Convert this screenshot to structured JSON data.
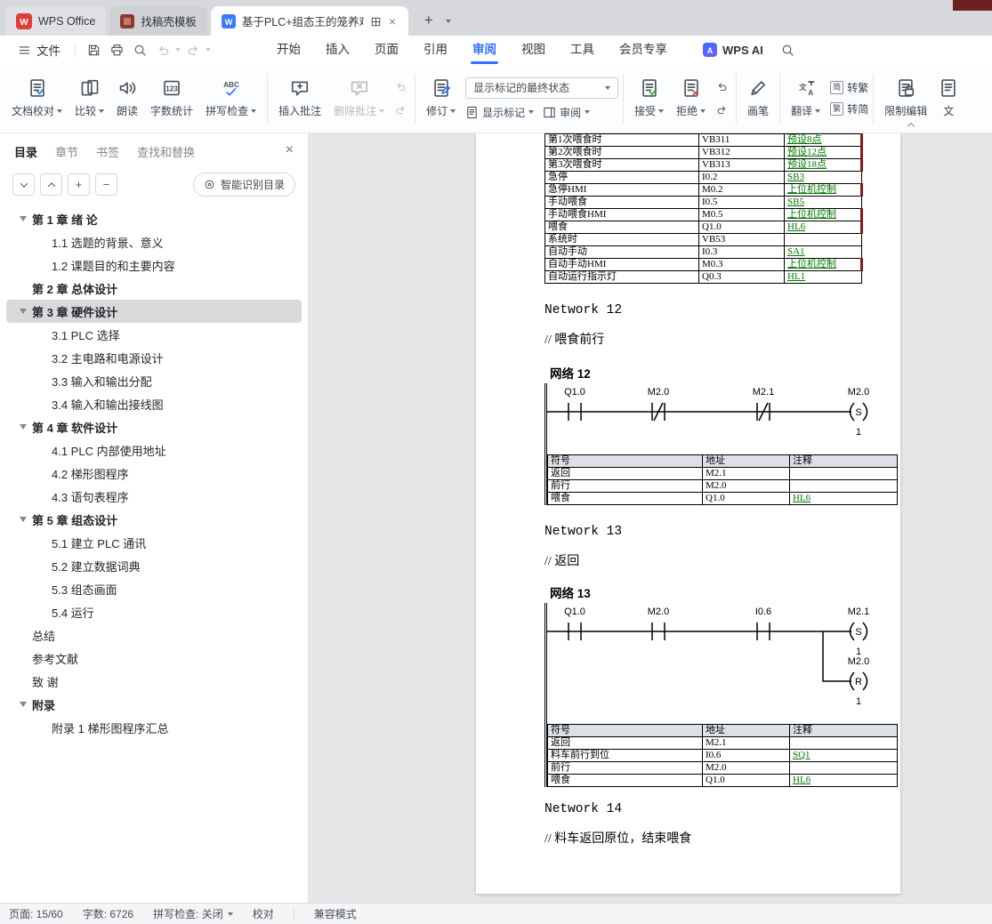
{
  "colors": {
    "accent": "#3370ff",
    "symbol_green": "#007a00",
    "revision_red": "#8b1a1a"
  },
  "titlebar": {
    "wps_tab": "WPS Office",
    "template_tab": "找稿壳模板",
    "doc_tab": "基于PLC+组态王的笼养鸡养殖",
    "new_tab_plus": "+"
  },
  "menubar": {
    "file": "文件",
    "tabs": [
      {
        "label": "开始"
      },
      {
        "label": "插入"
      },
      {
        "label": "页面"
      },
      {
        "label": "引用"
      },
      {
        "label": "审阅",
        "active": true
      },
      {
        "label": "视图"
      },
      {
        "label": "工具"
      },
      {
        "label": "会员专享"
      }
    ],
    "ai": "WPS AI"
  },
  "ribbon": {
    "proof": "文档校对",
    "compare": "比较",
    "read": "朗读",
    "word_count": "字数统计",
    "spell_check": "拼写检查",
    "insert_comment": "插入批注",
    "delete_comment": "删除批注",
    "track_changes": "修订",
    "display_state": "显示标记的最终状态",
    "show_marks": "显示标记",
    "review_pane": "审阅",
    "accept": "接受",
    "reject": "拒绝",
    "brush": "画笔",
    "translate": "翻译",
    "s2t_tag": "简",
    "s2t": "转繁",
    "t2s_tag": "繁",
    "t2s": "转简",
    "restrict_edit": "限制编辑",
    "clipped": "文"
  },
  "sidebar": {
    "tabs": [
      {
        "label": "目录",
        "active": true
      },
      {
        "label": "章节"
      },
      {
        "label": "书签"
      },
      {
        "label": "查找和替换"
      }
    ],
    "smart_toc": "智能识别目录",
    "toc": [
      {
        "label": "第 1 章 绪 论",
        "bold": true,
        "arrow": true
      },
      {
        "label": "1.1 选题的背景、意义",
        "sub": true
      },
      {
        "label": "1.2 课题目的和主要内容",
        "sub": true
      },
      {
        "label": "第 2 章 总体设计",
        "bold": true
      },
      {
        "label": "第 3 章 硬件设计",
        "bold": true,
        "arrow": true,
        "selected": true
      },
      {
        "label": "3.1 PLC 选择",
        "sub": true
      },
      {
        "label": "3.2 主电路和电源设计",
        "sub": true
      },
      {
        "label": "3.3 输入和输出分配",
        "sub": true
      },
      {
        "label": "3.4 输入和输出接线图",
        "sub": true
      },
      {
        "label": "第 4 章 软件设计",
        "bold": true,
        "arrow": true
      },
      {
        "label": "4.1 PLC 内部使用地址",
        "sub": true
      },
      {
        "label": "4.2 梯形图程序",
        "sub": true
      },
      {
        "label": "4.3 语句表程序",
        "sub": true
      },
      {
        "label": "第 5 章 组态设计",
        "bold": true,
        "arrow": true
      },
      {
        "label": "5.1 建立 PLC 通讯",
        "sub": true
      },
      {
        "label": "5.2 建立数据词典",
        "sub": true
      },
      {
        "label": "5.3 组态画面",
        "sub": true
      },
      {
        "label": "5.4 运行",
        "sub": true
      },
      {
        "label": "总结"
      },
      {
        "label": "参考文献"
      },
      {
        "label": "致 谢"
      },
      {
        "label": "附录",
        "bold": true,
        "arrow": true
      },
      {
        "label": "附录 1 梯形图程序汇总",
        "sub": true
      }
    ]
  },
  "doc": {
    "io_table_rows": [
      {
        "c": [
          "第1次喂食时",
          "VB311",
          "预设8点"
        ],
        "marked": true
      },
      {
        "c": [
          "第2次喂食时",
          "VB312",
          "预设12点"
        ],
        "marked": true
      },
      {
        "c": [
          "第3次喂食时",
          "VB313",
          "预设18点"
        ],
        "marked": true
      },
      {
        "c": [
          "急停",
          "I0.2",
          "SB3"
        ]
      },
      {
        "c": [
          "急停HMI",
          "M0.2",
          "上位机控制"
        ],
        "marked": true
      },
      {
        "c": [
          "手动喂食",
          "I0.5",
          "SB5"
        ]
      },
      {
        "c": [
          "手动喂食HMI",
          "M0.5",
          "上位机控制"
        ],
        "marked": true
      },
      {
        "c": [
          "喂食",
          "Q1.0",
          "HL6"
        ],
        "marked": true
      },
      {
        "c": [
          "系统时",
          "VB53",
          ""
        ]
      },
      {
        "c": [
          "自动手动",
          "I0.3",
          "SA1"
        ]
      },
      {
        "c": [
          "自动手动HMI",
          "M0.3",
          "上位机控制"
        ],
        "marked": true
      },
      {
        "c": [
          "自动运行指示灯",
          "Q0.3",
          "HL1"
        ]
      }
    ],
    "networks": [
      {
        "title": "Network 12",
        "comment": "// 喂食前行",
        "label": "网络 12",
        "ladder": {
          "contacts": [
            {
              "name": "Q1.0"
            },
            {
              "name": "M2.0",
              "nc": true
            },
            {
              "name": "M2.1",
              "nc": true
            }
          ],
          "coils": [
            {
              "name": "M2.0",
              "op": "S",
              "count": "1"
            }
          ]
        },
        "symbols": {
          "headers": [
            "符号",
            "地址",
            "注释"
          ],
          "rows": [
            {
              "c": [
                "返回",
                "M2.1",
                ""
              ]
            },
            {
              "c": [
                "前行",
                "M2.0",
                ""
              ]
            },
            {
              "c": [
                "喂食",
                "Q1.0",
                "HL6"
              ]
            }
          ]
        }
      },
      {
        "title": "Network 13",
        "comment": "// 返回",
        "label": "网络 13",
        "ladder": {
          "contacts": [
            {
              "name": "Q1.0"
            },
            {
              "name": "M2.0"
            },
            {
              "name": "I0.6"
            }
          ],
          "coils": [
            {
              "name": "M2.1",
              "op": "S",
              "count": "1"
            },
            {
              "name": "M2.0",
              "op": "R",
              "count": "1"
            }
          ]
        },
        "symbols": {
          "headers": [
            "符号",
            "地址",
            "注释"
          ],
          "rows": [
            {
              "c": [
                "返回",
                "M2.1",
                ""
              ]
            },
            {
              "c": [
                "料车前行到位",
                "I0.6",
                "SQ1"
              ]
            },
            {
              "c": [
                "前行",
                "M2.0",
                ""
              ]
            },
            {
              "c": [
                "喂食",
                "Q1.0",
                "HL6"
              ]
            }
          ]
        }
      },
      {
        "title": "Network 14",
        "comment": "// 料车返回原位，结束喂食"
      }
    ]
  },
  "statusbar": {
    "page": "页面: 15/60",
    "words": "字数: 6726",
    "spell": "拼写检查: 关闭",
    "proof": "校对",
    "mode": "兼容模式"
  }
}
